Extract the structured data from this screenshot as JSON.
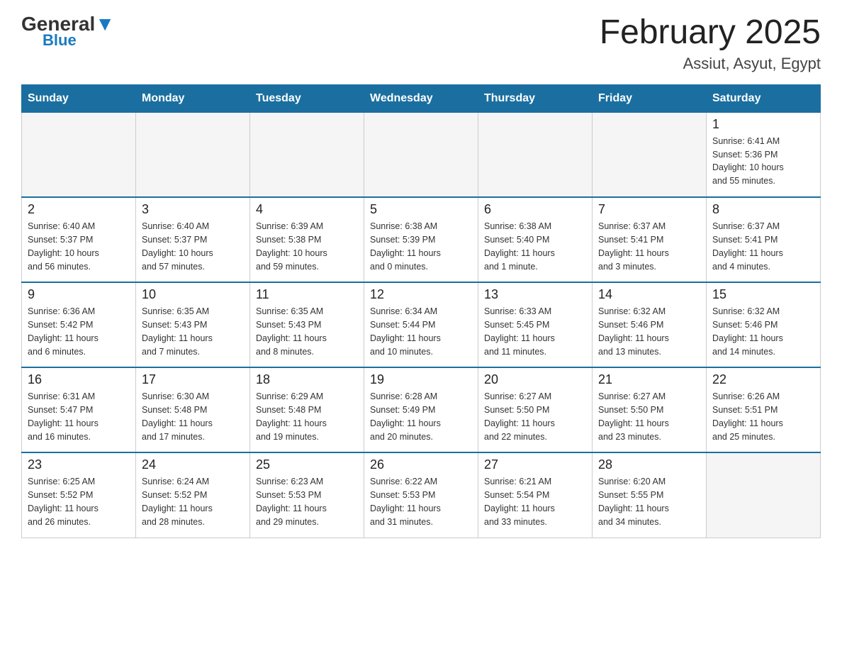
{
  "header": {
    "logo_general": "General",
    "logo_blue": "Blue",
    "month_title": "February 2025",
    "location": "Assiut, Asyut, Egypt"
  },
  "weekdays": [
    "Sunday",
    "Monday",
    "Tuesday",
    "Wednesday",
    "Thursday",
    "Friday",
    "Saturday"
  ],
  "weeks": [
    [
      {
        "day": "",
        "info": ""
      },
      {
        "day": "",
        "info": ""
      },
      {
        "day": "",
        "info": ""
      },
      {
        "day": "",
        "info": ""
      },
      {
        "day": "",
        "info": ""
      },
      {
        "day": "",
        "info": ""
      },
      {
        "day": "1",
        "info": "Sunrise: 6:41 AM\nSunset: 5:36 PM\nDaylight: 10 hours\nand 55 minutes."
      }
    ],
    [
      {
        "day": "2",
        "info": "Sunrise: 6:40 AM\nSunset: 5:37 PM\nDaylight: 10 hours\nand 56 minutes."
      },
      {
        "day": "3",
        "info": "Sunrise: 6:40 AM\nSunset: 5:37 PM\nDaylight: 10 hours\nand 57 minutes."
      },
      {
        "day": "4",
        "info": "Sunrise: 6:39 AM\nSunset: 5:38 PM\nDaylight: 10 hours\nand 59 minutes."
      },
      {
        "day": "5",
        "info": "Sunrise: 6:38 AM\nSunset: 5:39 PM\nDaylight: 11 hours\nand 0 minutes."
      },
      {
        "day": "6",
        "info": "Sunrise: 6:38 AM\nSunset: 5:40 PM\nDaylight: 11 hours\nand 1 minute."
      },
      {
        "day": "7",
        "info": "Sunrise: 6:37 AM\nSunset: 5:41 PM\nDaylight: 11 hours\nand 3 minutes."
      },
      {
        "day": "8",
        "info": "Sunrise: 6:37 AM\nSunset: 5:41 PM\nDaylight: 11 hours\nand 4 minutes."
      }
    ],
    [
      {
        "day": "9",
        "info": "Sunrise: 6:36 AM\nSunset: 5:42 PM\nDaylight: 11 hours\nand 6 minutes."
      },
      {
        "day": "10",
        "info": "Sunrise: 6:35 AM\nSunset: 5:43 PM\nDaylight: 11 hours\nand 7 minutes."
      },
      {
        "day": "11",
        "info": "Sunrise: 6:35 AM\nSunset: 5:43 PM\nDaylight: 11 hours\nand 8 minutes."
      },
      {
        "day": "12",
        "info": "Sunrise: 6:34 AM\nSunset: 5:44 PM\nDaylight: 11 hours\nand 10 minutes."
      },
      {
        "day": "13",
        "info": "Sunrise: 6:33 AM\nSunset: 5:45 PM\nDaylight: 11 hours\nand 11 minutes."
      },
      {
        "day": "14",
        "info": "Sunrise: 6:32 AM\nSunset: 5:46 PM\nDaylight: 11 hours\nand 13 minutes."
      },
      {
        "day": "15",
        "info": "Sunrise: 6:32 AM\nSunset: 5:46 PM\nDaylight: 11 hours\nand 14 minutes."
      }
    ],
    [
      {
        "day": "16",
        "info": "Sunrise: 6:31 AM\nSunset: 5:47 PM\nDaylight: 11 hours\nand 16 minutes."
      },
      {
        "day": "17",
        "info": "Sunrise: 6:30 AM\nSunset: 5:48 PM\nDaylight: 11 hours\nand 17 minutes."
      },
      {
        "day": "18",
        "info": "Sunrise: 6:29 AM\nSunset: 5:48 PM\nDaylight: 11 hours\nand 19 minutes."
      },
      {
        "day": "19",
        "info": "Sunrise: 6:28 AM\nSunset: 5:49 PM\nDaylight: 11 hours\nand 20 minutes."
      },
      {
        "day": "20",
        "info": "Sunrise: 6:27 AM\nSunset: 5:50 PM\nDaylight: 11 hours\nand 22 minutes."
      },
      {
        "day": "21",
        "info": "Sunrise: 6:27 AM\nSunset: 5:50 PM\nDaylight: 11 hours\nand 23 minutes."
      },
      {
        "day": "22",
        "info": "Sunrise: 6:26 AM\nSunset: 5:51 PM\nDaylight: 11 hours\nand 25 minutes."
      }
    ],
    [
      {
        "day": "23",
        "info": "Sunrise: 6:25 AM\nSunset: 5:52 PM\nDaylight: 11 hours\nand 26 minutes."
      },
      {
        "day": "24",
        "info": "Sunrise: 6:24 AM\nSunset: 5:52 PM\nDaylight: 11 hours\nand 28 minutes."
      },
      {
        "day": "25",
        "info": "Sunrise: 6:23 AM\nSunset: 5:53 PM\nDaylight: 11 hours\nand 29 minutes."
      },
      {
        "day": "26",
        "info": "Sunrise: 6:22 AM\nSunset: 5:53 PM\nDaylight: 11 hours\nand 31 minutes."
      },
      {
        "day": "27",
        "info": "Sunrise: 6:21 AM\nSunset: 5:54 PM\nDaylight: 11 hours\nand 33 minutes."
      },
      {
        "day": "28",
        "info": "Sunrise: 6:20 AM\nSunset: 5:55 PM\nDaylight: 11 hours\nand 34 minutes."
      },
      {
        "day": "",
        "info": ""
      }
    ]
  ]
}
